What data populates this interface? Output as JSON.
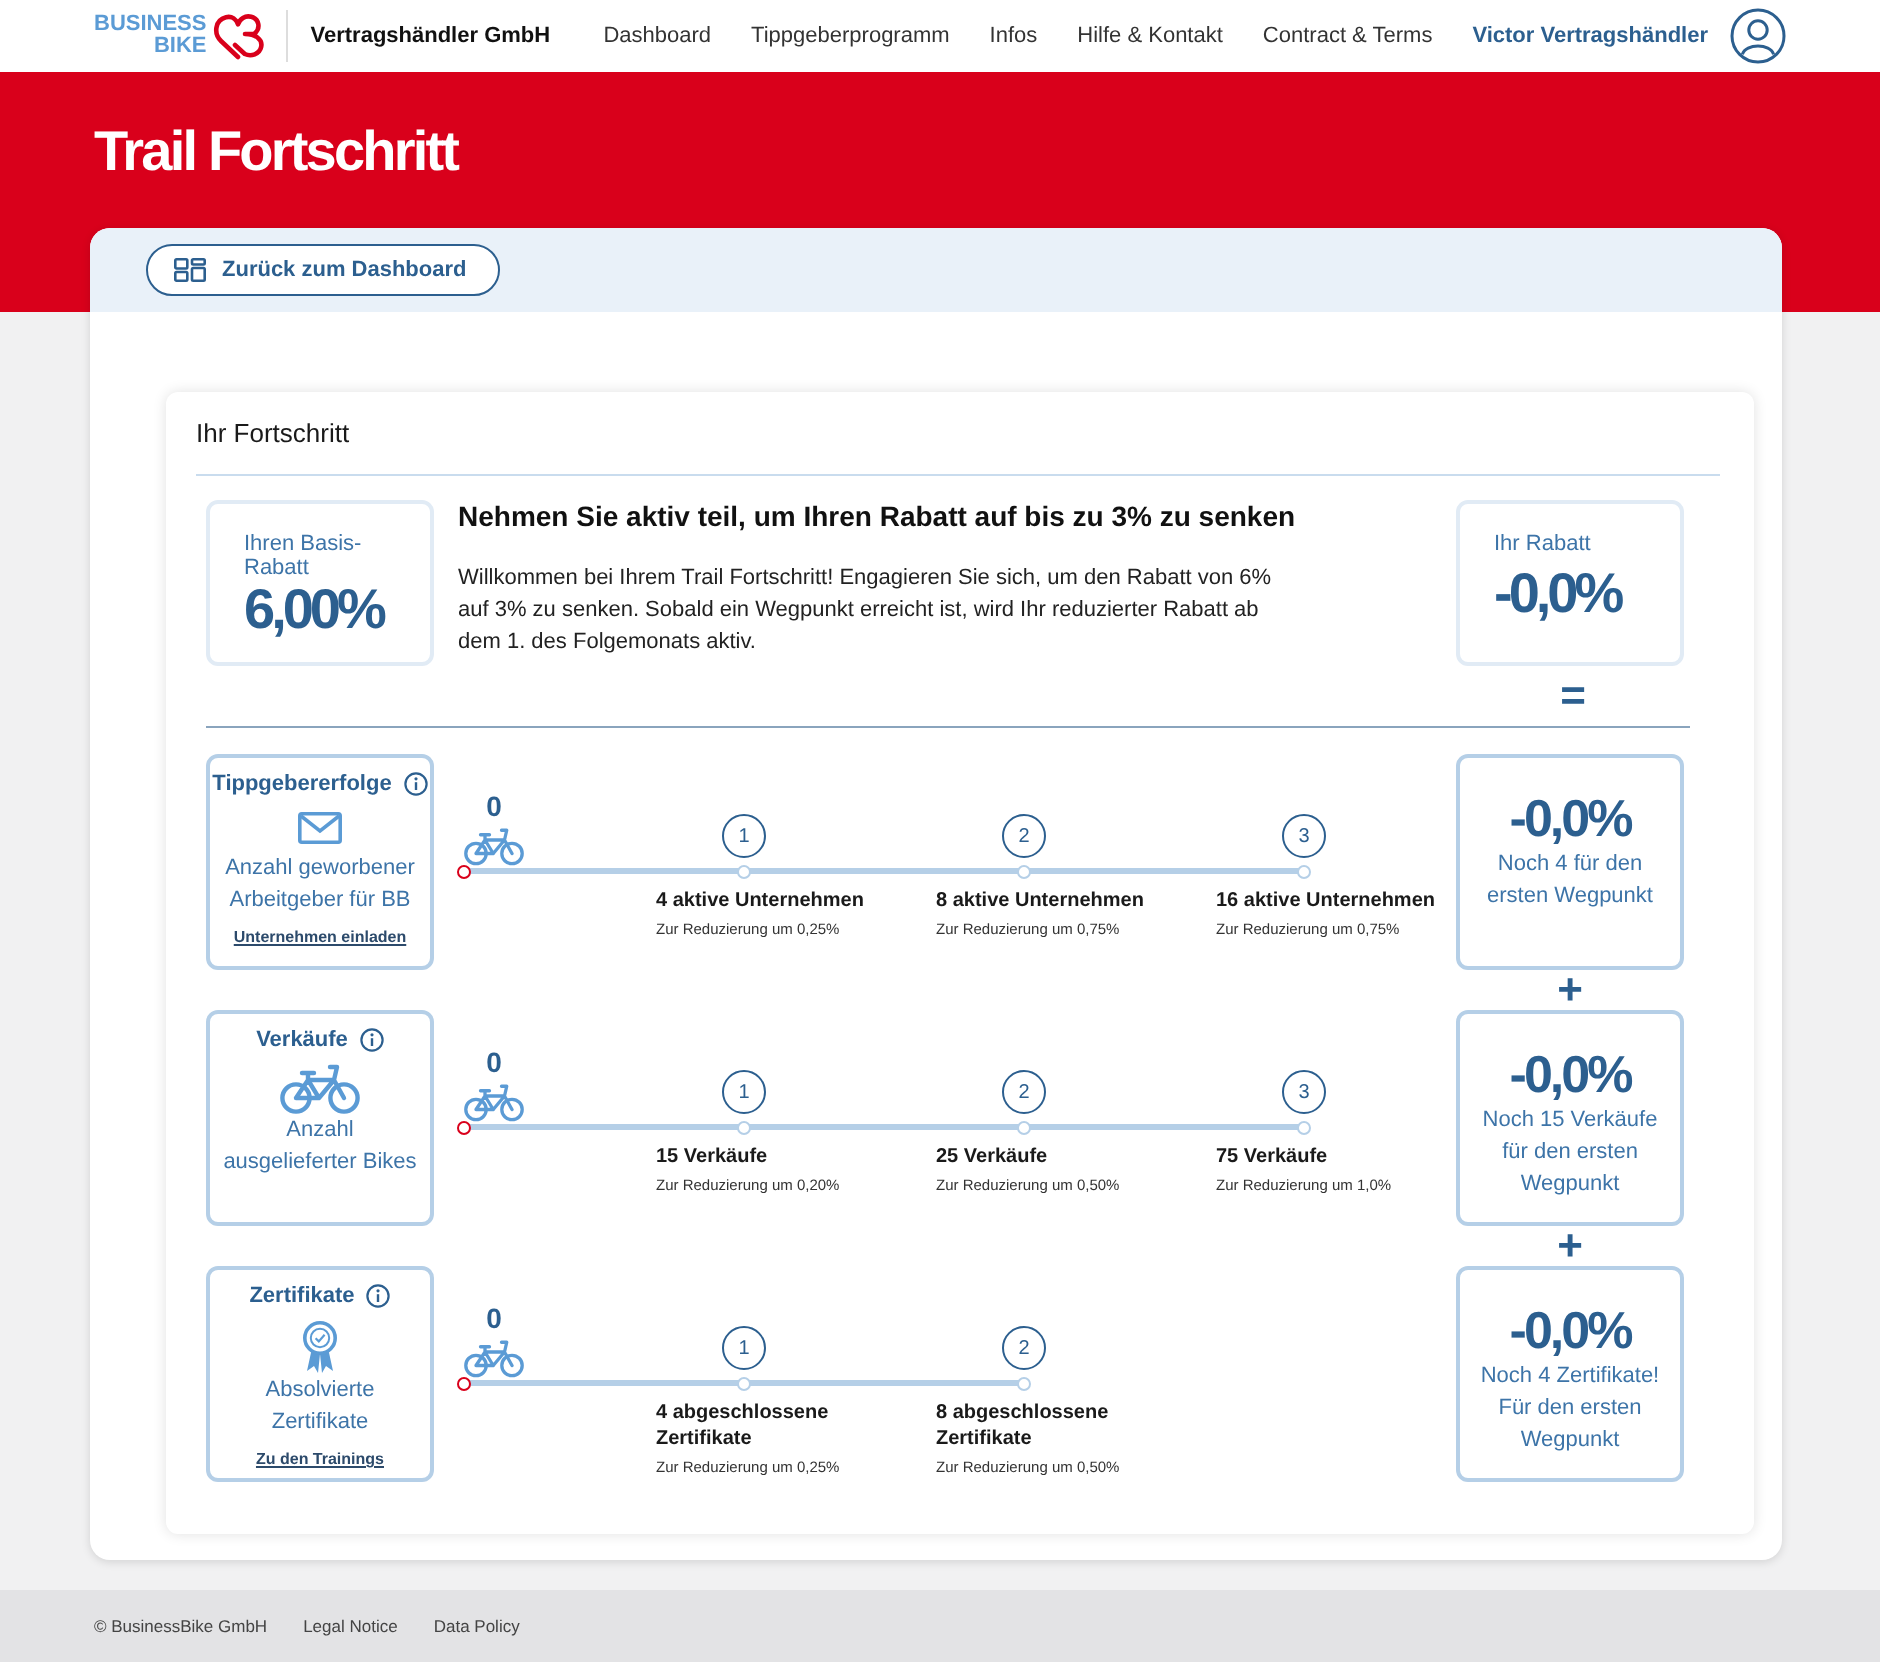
{
  "header": {
    "logo_lines": [
      "BUSINESS",
      "BIKE"
    ],
    "company": "Vertragshändler GmbH",
    "nav": [
      "Dashboard",
      "Tippgeberprogramm",
      "Infos",
      "Hilfe & Kontakt",
      "Contract & Terms"
    ],
    "user": "Victor Vertragshändler"
  },
  "page_title": "Trail Fortschritt",
  "back_button": "Zurück zum Dashboard",
  "progress": {
    "title": "Ihr Fortschritt",
    "base_discount": {
      "label": "Ihren Basis-Rabatt",
      "value": "6,00%"
    },
    "intro": {
      "heading": "Nehmen Sie aktiv teil, um Ihren Rabatt auf bis zu 3% zu senken",
      "text": "Willkommen bei Ihrem Trail Fortschritt! Engagieren Sie sich, um den Rabatt von 6% auf 3% zu senken. Sobald ein Wegpunkt erreicht ist, wird Ihr reduzierter Rabatt ab dem 1. des Folgemonats aktiv."
    },
    "your_discount": {
      "label": "Ihr Rabatt",
      "value": "-0,0%"
    },
    "equals_sign": "=",
    "categories": [
      {
        "title": "Tippgebererfolge",
        "description": "Anzahl geworbener Arbeitgeber für BB",
        "link": "Unternehmen einladen",
        "count": "0",
        "level": 0,
        "milestones": [
          {
            "number": "1",
            "target": "4 aktive Unternehmen",
            "reduction": "Zur Reduzierung um 0,25%"
          },
          {
            "number": "2",
            "target": "8 aktive Unternehmen",
            "reduction": "Zur Reduzierung um 0,75%"
          },
          {
            "number": "3",
            "target": "16 aktive Unternehmen",
            "reduction": "Zur Reduzierung um 0,75%"
          }
        ],
        "result": {
          "value": "-0,0%",
          "text": "Noch 4 für den ersten Wegpunkt"
        }
      },
      {
        "joiner": "+",
        "title": "Verkäufe",
        "description": "Anzahl ausgelieferter Bikes",
        "count": "0",
        "level": 0,
        "milestones": [
          {
            "number": "1",
            "target": "15 Verkäufe",
            "reduction": "Zur Reduzierung um 0,20%"
          },
          {
            "number": "2",
            "target": "25 Verkäufe",
            "reduction": "Zur Reduzierung um 0,50%"
          },
          {
            "number": "3",
            "target": "75 Verkäufe",
            "reduction": "Zur Reduzierung um 1,0%"
          }
        ],
        "result": {
          "value": "-0,0%",
          "text": "Noch 15 Verkäufe für den ersten Wegpunkt"
        }
      },
      {
        "joiner": "+",
        "title": "Zertifikate",
        "description": "Absolvierte Zertifikate",
        "link": "Zu den Trainings",
        "count": "0",
        "level": 0,
        "milestones": [
          {
            "number": "1",
            "target": "4 abgeschlossene Zertifikate",
            "reduction": "Zur Reduzierung um 0,25%"
          },
          {
            "number": "2",
            "target": "8 abgeschlossene Zertifikate",
            "reduction": "Zur Reduzierung um 0,50%"
          }
        ],
        "result": {
          "value": "-0,0%",
          "text": "Noch 4 Zertifikate! Für den ersten Wegpunkt"
        }
      }
    ]
  },
  "footer": {
    "copyright": "© BusinessBike GmbH",
    "links": [
      "Legal Notice",
      "Data Policy"
    ]
  }
}
